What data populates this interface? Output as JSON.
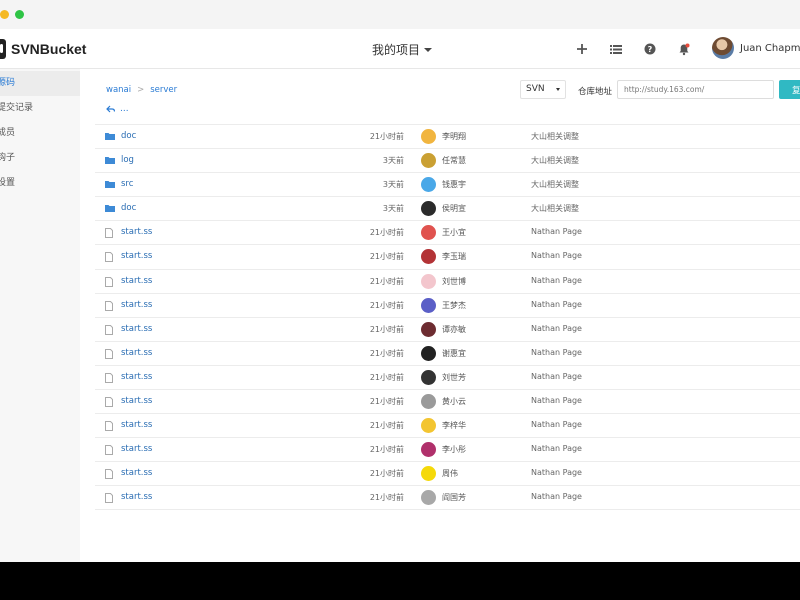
{
  "app": {
    "name": "SVNBucket"
  },
  "header": {
    "project_menu_label": "我的项目",
    "user_name": "Juan Chapman",
    "icons": [
      "plus-icon",
      "list-icon",
      "help-icon",
      "bell-icon"
    ]
  },
  "sidebar": {
    "items": [
      {
        "label": "源码",
        "active": true
      },
      {
        "label": "提交记录"
      },
      {
        "label": "成员"
      },
      {
        "label": "钩子"
      },
      {
        "label": "设置"
      }
    ]
  },
  "breadcrumb": {
    "items": [
      "wanai",
      "server"
    ],
    "separator": ">"
  },
  "back_label": "...",
  "toolbar": {
    "vcs_type": "SVN",
    "repo_label": "仓库地址",
    "repo_url": "http://study.163.com/",
    "copy_label": "复"
  },
  "colors": {
    "accent": "#2a7bd4",
    "button": "#30b9c3",
    "folder": "#3d8ad6"
  },
  "files": [
    {
      "type": "folder",
      "name": "doc",
      "time": "21小时前",
      "author": "李明翔",
      "message": "大山相关调整",
      "avatar_color": "#f1b53f"
    },
    {
      "type": "folder",
      "name": "log",
      "time": "3天前",
      "author": "任常慧",
      "message": "大山相关调整",
      "avatar_color": "#caa033"
    },
    {
      "type": "folder",
      "name": "src",
      "time": "3天前",
      "author": "钱惠宇",
      "message": "大山相关调整",
      "avatar_color": "#4aa8e8"
    },
    {
      "type": "folder",
      "name": "doc",
      "time": "3天前",
      "author": "侯明宣",
      "message": "大山相关调整",
      "avatar_color": "#2b2b2b"
    },
    {
      "type": "file",
      "name": "start.ss",
      "time": "21小时前",
      "author": "王小宜",
      "message": "Nathan Page",
      "avatar_color": "#e0534f"
    },
    {
      "type": "file",
      "name": "start.ss",
      "time": "21小时前",
      "author": "李玉瑞",
      "message": "Nathan Page",
      "avatar_color": "#b33336"
    },
    {
      "type": "file",
      "name": "start.ss",
      "time": "21小时前",
      "author": "刘世博",
      "message": "Nathan Page",
      "avatar_color": "#f3c6cd"
    },
    {
      "type": "file",
      "name": "start.ss",
      "time": "21小时前",
      "author": "王梦杰",
      "message": "Nathan Page",
      "avatar_color": "#5b5fc7"
    },
    {
      "type": "file",
      "name": "start.ss",
      "time": "21小时前",
      "author": "谭亦敏",
      "message": "Nathan Page",
      "avatar_color": "#6d2c31"
    },
    {
      "type": "file",
      "name": "start.ss",
      "time": "21小时前",
      "author": "谢惠宜",
      "message": "Nathan Page",
      "avatar_color": "#222222"
    },
    {
      "type": "file",
      "name": "start.ss",
      "time": "21小时前",
      "author": "刘世芳",
      "message": "Nathan Page",
      "avatar_color": "#333333"
    },
    {
      "type": "file",
      "name": "start.ss",
      "time": "21小时前",
      "author": "黄小云",
      "message": "Nathan Page",
      "avatar_color": "#9a9a9a"
    },
    {
      "type": "file",
      "name": "start.ss",
      "time": "21小时前",
      "author": "李梓华",
      "message": "Nathan Page",
      "avatar_color": "#f3c531"
    },
    {
      "type": "file",
      "name": "start.ss",
      "time": "21小时前",
      "author": "李小彤",
      "message": "Nathan Page",
      "avatar_color": "#b0306b"
    },
    {
      "type": "file",
      "name": "start.ss",
      "time": "21小时前",
      "author": "周伟",
      "message": "Nathan Page",
      "avatar_color": "#f5d90a"
    },
    {
      "type": "file",
      "name": "start.ss",
      "time": "21小时前",
      "author": "阎国芳",
      "message": "Nathan Page",
      "avatar_color": "#a8a8a8"
    }
  ]
}
